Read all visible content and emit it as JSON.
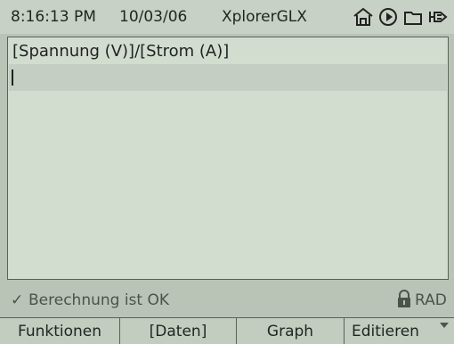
{
  "top_bar": {
    "time": "8:16:13 PM",
    "date": "10/03/06",
    "app_title": "XplorerGLX",
    "icons": [
      "home-icon",
      "play-icon",
      "folder-icon",
      "power-plug-icon"
    ]
  },
  "editor": {
    "formula_text": "[Spannung (V)]/[Strom (A)]",
    "input_value": ""
  },
  "status": {
    "message": "Berechnung ist OK",
    "check_icon": "check-icon",
    "lock_icon": "lock-icon",
    "angle_mode": "RAD"
  },
  "softkeys": [
    {
      "label": "Funktionen"
    },
    {
      "label": "[Daten]"
    },
    {
      "label": "Graph"
    },
    {
      "label": "Editieren"
    }
  ],
  "colors": {
    "background": "#b9c4b7",
    "panel": "#d2ddd0",
    "input_highlight": "#c4cec2",
    "text": "#1f261f"
  }
}
